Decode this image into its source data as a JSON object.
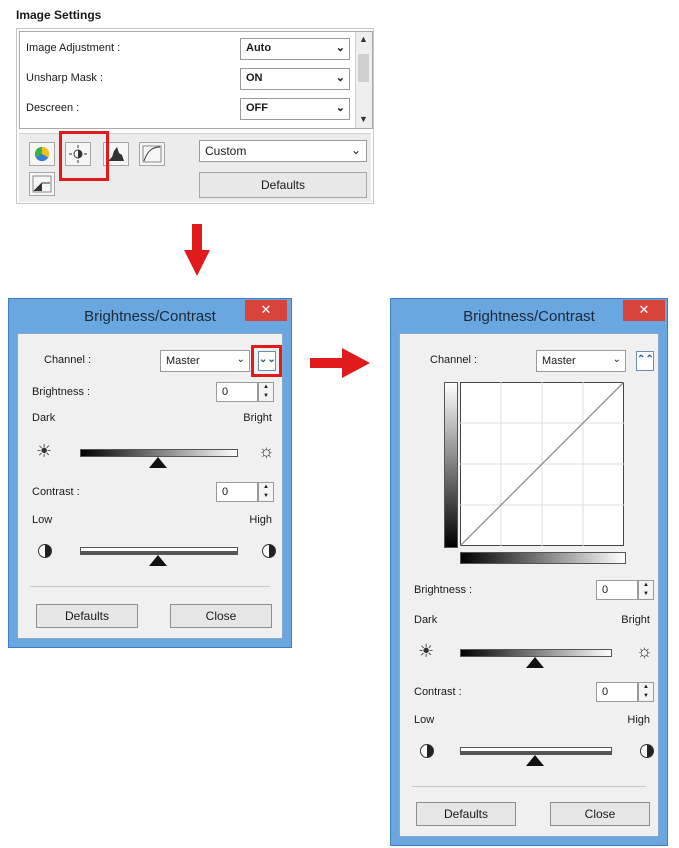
{
  "image_settings": {
    "title": "Image Settings",
    "rows": [
      {
        "label": "Image Adjustment :",
        "value": "Auto"
      },
      {
        "label": "Unsharp Mask :",
        "value": "ON"
      },
      {
        "label": "Descreen :",
        "value": "OFF"
      }
    ],
    "tone_select": "Custom",
    "defaults_label": "Defaults",
    "tools": [
      "color-wheel-icon",
      "brightness-contrast-icon",
      "histogram-icon",
      "tone-curve-icon",
      "threshold-icon"
    ]
  },
  "dialog_compact": {
    "title": "Brightness/Contrast",
    "close_x": "✕",
    "channel_label": "Channel :",
    "channel_value": "Master",
    "brightness_label": "Brightness :",
    "brightness_value": "0",
    "dark_label": "Dark",
    "bright_label": "Bright",
    "contrast_label": "Contrast :",
    "contrast_value": "0",
    "low_label": "Low",
    "high_label": "High",
    "defaults_label": "Defaults",
    "close_label": "Close"
  },
  "dialog_expanded": {
    "title": "Brightness/Contrast",
    "close_x": "✕",
    "channel_label": "Channel :",
    "channel_value": "Master",
    "brightness_label": "Brightness :",
    "brightness_value": "0",
    "dark_label": "Dark",
    "bright_label": "Bright",
    "contrast_label": "Contrast :",
    "contrast_value": "0",
    "low_label": "Low",
    "high_label": "High",
    "defaults_label": "Defaults",
    "close_label": "Close"
  },
  "colors": {
    "accent_red": "#e11b1b",
    "window_blue": "#6aa6e0",
    "close_red": "#d9443a"
  }
}
